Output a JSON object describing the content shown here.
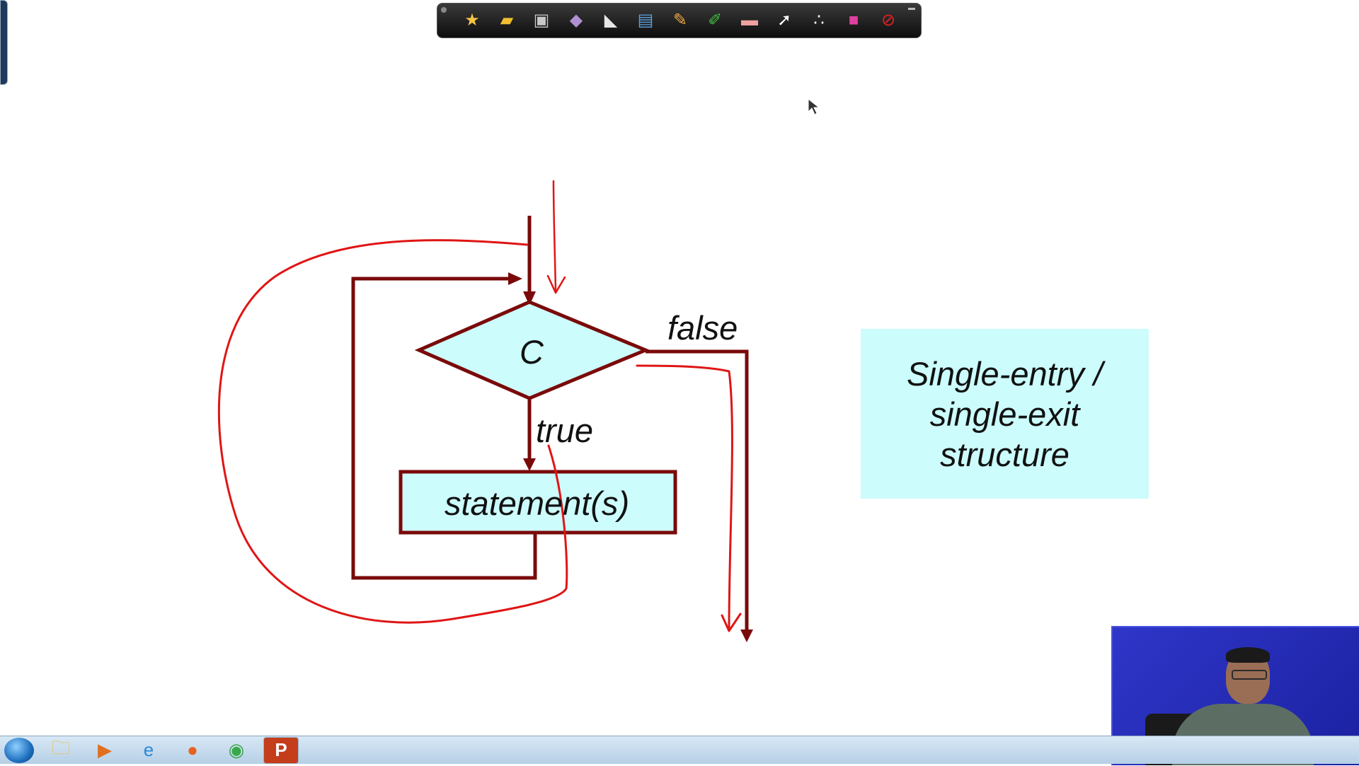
{
  "toolbar": {
    "tools": [
      {
        "name": "pointer-menu-icon",
        "glyph": "★",
        "color": "#f5c542"
      },
      {
        "name": "open-folder-icon",
        "glyph": "▰",
        "color": "#f0c030"
      },
      {
        "name": "save-icon",
        "glyph": "▣",
        "color": "#c8c8c8"
      },
      {
        "name": "pen-icon",
        "glyph": "◆",
        "color": "#b090d0"
      },
      {
        "name": "whiteboard-icon",
        "glyph": "◣",
        "color": "#e6e6e6"
      },
      {
        "name": "screenshot-icon",
        "glyph": "▤",
        "color": "#5aa0e0"
      },
      {
        "name": "pencil-icon",
        "glyph": "✎",
        "color": "#f0a840"
      },
      {
        "name": "highlighter-icon",
        "glyph": "✐",
        "color": "#40c040"
      },
      {
        "name": "eraser-icon",
        "glyph": "▬",
        "color": "#f0a0a0"
      },
      {
        "name": "cursor-icon",
        "glyph": "➚",
        "color": "#ffffff"
      },
      {
        "name": "clear-icon",
        "glyph": "∴",
        "color": "#ffffff"
      },
      {
        "name": "color-palette-icon",
        "glyph": "■",
        "color": "#e040a0"
      },
      {
        "name": "stop-icon",
        "glyph": "⊘",
        "color": "#e02020"
      }
    ]
  },
  "diagram": {
    "condition_label": "C",
    "true_label": "true",
    "false_label": "false",
    "statement_label": "statement(s)",
    "colors": {
      "line": "#7a0a0a",
      "fill": "#ccfcfc",
      "annotation": "#e01515"
    }
  },
  "info_box": {
    "lines": [
      "Single-entry /",
      "single-exit",
      "structure"
    ],
    "background": "#ccfcfc"
  },
  "taskbar": {
    "apps": [
      {
        "name": "start-button",
        "glyph": ""
      },
      {
        "name": "file-explorer-icon",
        "glyph": "🗀",
        "color": "#e8c050"
      },
      {
        "name": "media-player-icon",
        "glyph": "▶",
        "color": "#e07020"
      },
      {
        "name": "internet-explorer-icon",
        "glyph": "e",
        "color": "#2a8ad8"
      },
      {
        "name": "firefox-icon",
        "glyph": "●",
        "color": "#e86020"
      },
      {
        "name": "chrome-icon",
        "glyph": "◉",
        "color": "#3aa84a"
      },
      {
        "name": "powerpoint-icon",
        "glyph": "P",
        "color": "#ffffff"
      }
    ]
  }
}
